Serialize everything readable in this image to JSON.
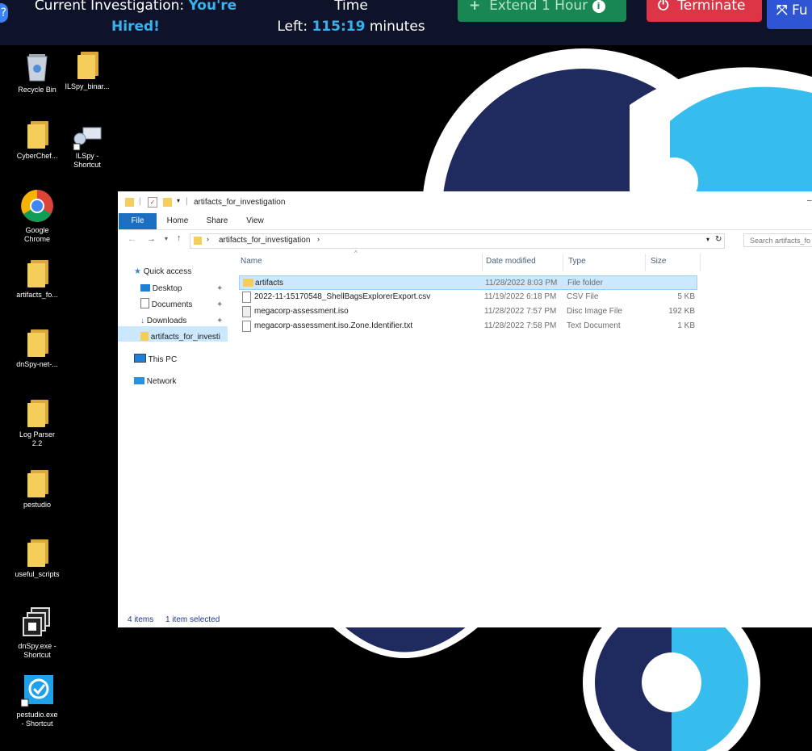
{
  "session": {
    "investigation_label": "Current Investigation:",
    "investigation_name_1": "You're",
    "investigation_name_2": "Hired!",
    "time_label": "Time",
    "left_label": "Left:",
    "time_left": "115:19",
    "time_unit": "minutes",
    "extend_label": "Extend 1 Hour",
    "terminate_label": "Terminate",
    "fullscreen_label": "Fu"
  },
  "desktop": {
    "icons": [
      {
        "label1": "Recycle Bin",
        "label2": ""
      },
      {
        "label1": "ILSpy_binar...",
        "label2": ""
      },
      {
        "label1": "CyberChef...",
        "label2": ""
      },
      {
        "label1": "ILSpy -",
        "label2": "Shortcut"
      },
      {
        "label1": "Google",
        "label2": "Chrome"
      },
      {
        "label1": "artifacts_fo...",
        "label2": ""
      },
      {
        "label1": "dnSpy-net-...",
        "label2": ""
      },
      {
        "label1": "Log Parser",
        "label2": "2.2"
      },
      {
        "label1": "pestudio",
        "label2": ""
      },
      {
        "label1": "useful_scripts",
        "label2": ""
      },
      {
        "label1": "dnSpy.exe -",
        "label2": "Shortcut"
      },
      {
        "label1": "pestudio.exe",
        "label2": "- Shortcut"
      }
    ]
  },
  "explorer": {
    "title": "artifacts_for_investigation",
    "tabs": [
      "File",
      "Home",
      "Share",
      "View"
    ],
    "breadcrumb": [
      "artifacts_for_investigation"
    ],
    "search_placeholder": "Search artifacts_fo",
    "nav": {
      "quick_access": "Quick access",
      "desktop": "Desktop",
      "documents": "Documents",
      "downloads": "Downloads",
      "artifacts": "artifacts_for_investi",
      "this_pc": "This PC",
      "network": "Network"
    },
    "columns": {
      "name": "Name",
      "date": "Date modified",
      "type": "Type",
      "size": "Size"
    },
    "files": [
      {
        "name": "artifacts",
        "date": "11/28/2022 8:03 PM",
        "type": "File folder",
        "size": ""
      },
      {
        "name": "2022-11-15170548_ShellBagsExplorerExport.csv",
        "date": "11/19/2022 6:18 PM",
        "type": "CSV File",
        "size": "5 KB"
      },
      {
        "name": "megacorp-assessment.iso",
        "date": "11/28/2022 7:57 PM",
        "type": "Disc Image File",
        "size": "192 KB"
      },
      {
        "name": "megacorp-assessment.iso.Zone.Identifier.txt",
        "date": "11/28/2022 7:58 PM",
        "type": "Text Document",
        "size": "1 KB"
      }
    ],
    "status": {
      "count": "4 items",
      "selected": "1 item selected"
    }
  }
}
